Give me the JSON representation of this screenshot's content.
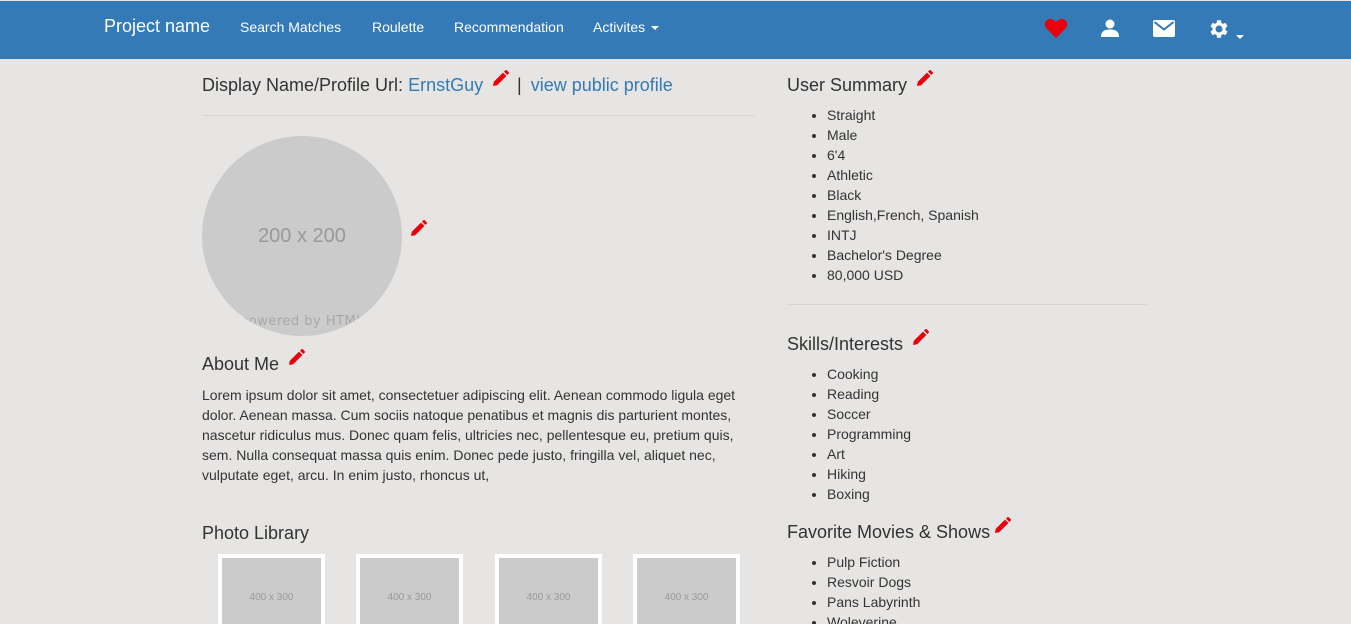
{
  "nav": {
    "brand": "Project name",
    "links": [
      "Search Matches",
      "Roulette",
      "Recommendation"
    ],
    "dropdown": "Activites",
    "icons": [
      "heart-icon",
      "user-icon",
      "envelope-icon",
      "gear-icon"
    ]
  },
  "profile": {
    "display_label": "Display Name/Profile Url:",
    "username": "ErnstGuy",
    "separator": "|",
    "public_link": "view public profile",
    "avatar_size": "200 x 200",
    "avatar_powered": "powered by HTML"
  },
  "about": {
    "title": "About Me",
    "text": "Lorem ipsum dolor sit amet, consectetuer adipiscing elit. Aenean commodo ligula eget dolor. Aenean massa. Cum sociis natoque penatibus et magnis dis parturient montes, nascetur ridiculus mus. Donec quam felis, ultricies nec, pellentesque eu, pretium quis, sem. Nulla consequat massa quis enim. Donec pede justo, fringilla vel, aliquet nec, vulputate eget, arcu. In enim justo, rhoncus ut,"
  },
  "photos": {
    "title": "Photo Library",
    "items": [
      "400 x 300",
      "400 x 300",
      "400 x 300",
      "400 x 300"
    ]
  },
  "summary": {
    "title": "User Summary",
    "items": [
      "Straight",
      "Male",
      "6'4",
      "Athletic",
      "Black",
      "English,French, Spanish",
      "INTJ",
      "Bachelor's Degree",
      "80,000 USD"
    ]
  },
  "skills": {
    "title": "Skills/Interests",
    "items": [
      "Cooking",
      "Reading",
      "Soccer",
      "Programming",
      "Art",
      "Hiking",
      "Boxing"
    ]
  },
  "movies": {
    "title": "Favorite Movies & Shows",
    "items": [
      "Pulp Fiction",
      "Resvoir Dogs",
      "Pans Labyrinth",
      "Woleverine"
    ]
  },
  "colors": {
    "navbar": "#337ab7",
    "accent_edit": "#e8000b",
    "link": "#337ab7",
    "background": "#e6e5e3"
  }
}
